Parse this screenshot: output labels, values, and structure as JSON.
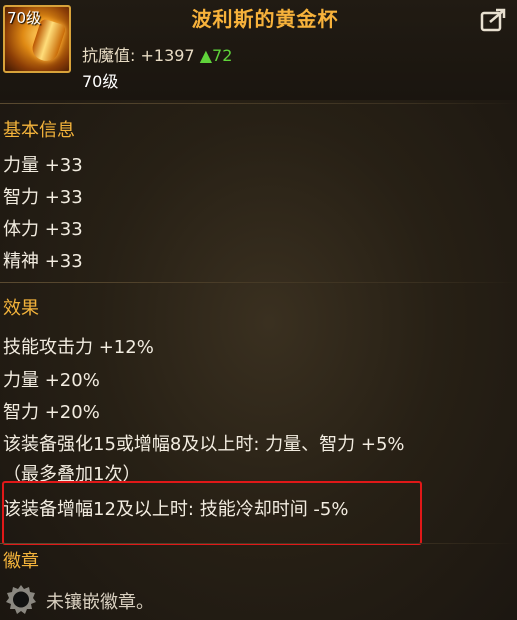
{
  "item": {
    "name": "波利斯的黄金杯",
    "icon_level_tag": "70级",
    "stat_label": "抗魔值: +1397",
    "stat_change": "▲72",
    "level": "70级",
    "icon": "golden-cup-icon"
  },
  "share_icon": "share-export-icon",
  "basic_info": {
    "title": "基本信息",
    "lines": [
      "力量 +33",
      "智力 +33",
      "体力 +33",
      "精神 +33"
    ]
  },
  "effects": {
    "title": "效果",
    "lines": [
      "技能攻击力 +12%",
      "力量 +20%",
      "智力 +20%",
      "该装备强化15或增幅8及以上时: 力量、智力 +5%",
      "（最多叠加1次）",
      "该装备增幅12及以上时: 技能冷却时间 -5%"
    ]
  },
  "emblem": {
    "title": "徽章",
    "status": "未镶嵌徽章。",
    "icon": "empty-emblem-slot-icon"
  },
  "colors": {
    "title_gold": "#f7b23b",
    "section_gold": "#f3b33b",
    "increase_green": "#5fd33a",
    "highlight_red": "#e01818"
  }
}
